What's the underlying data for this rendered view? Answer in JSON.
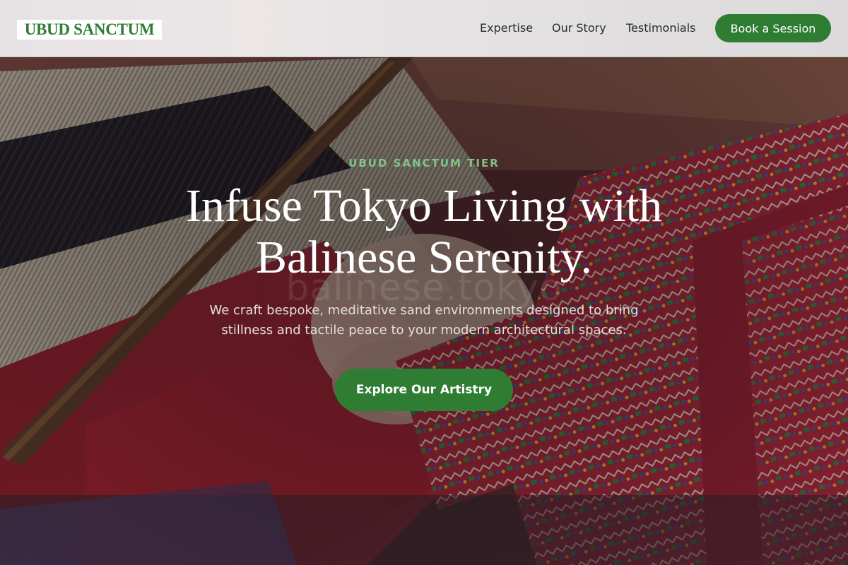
{
  "header": {
    "logo": "UBUD SANCTUM",
    "nav": [
      "Expertise",
      "Our Story",
      "Testimonials"
    ],
    "cta_label": "Book a Session"
  },
  "hero": {
    "eyebrow": "UBUD SANCTUM TIER",
    "headline_line1": "Infuse Tokyo Living with",
    "headline_line2": "Balinese Serenity.",
    "watermark": "balinese.tokyo",
    "subtext_line1": "We craft bespoke, meditative sand environments designed to bring",
    "subtext_line2": "stillness and tactile peace to your modern architectural spaces.",
    "cta_label": "Explore Our Artistry"
  },
  "colors": {
    "brand_green": "#2e7d32",
    "eyebrow_green": "#7fc587",
    "header_bg": "#e6e3e4"
  }
}
